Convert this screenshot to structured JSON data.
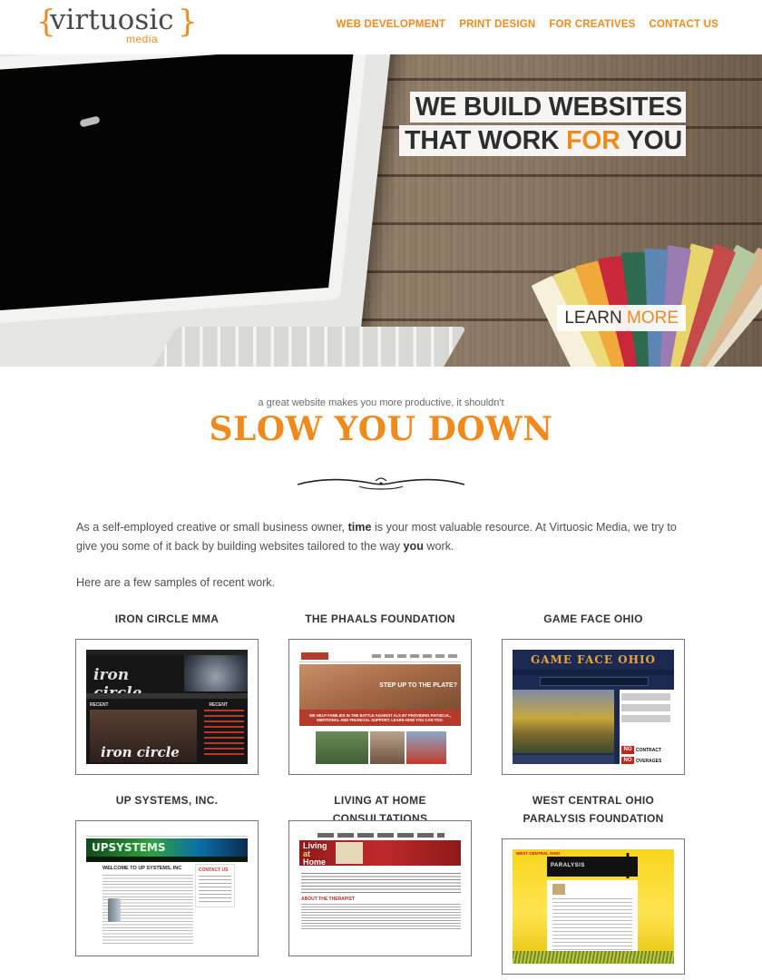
{
  "header": {
    "logo_word": "virtuosic",
    "logo_sub": "media",
    "logo_brace_left": "{",
    "logo_brace_right": "}",
    "nav": [
      "WEB DEVELOPMENT",
      "PRINT DESIGN",
      "FOR CREATIVES",
      "CONTACT US"
    ]
  },
  "hero": {
    "line1": "WE BUILD WEBSITES",
    "line2_a": "THAT WORK ",
    "line2_hl": "FOR",
    "line2_b": " YOU",
    "learn_a": "LEARN ",
    "learn_hl": "MORE"
  },
  "intro": {
    "kicker": "a great website makes you more productive, it shouldn't",
    "headline": "SLOW YOU DOWN",
    "p1_a": "As a self-employed creative or small business owner, ",
    "p1_b1": "time",
    "p1_c": " is your most valuable resource. At Virtuosic Media, we try to give you some of it back by building websites tailored to the way ",
    "p1_b2": "you",
    "p1_d": " work.",
    "p2": "Here are a few samples of recent work."
  },
  "portfolio": [
    {
      "title": "IRON CIRCLE MMA"
    },
    {
      "title": "THE PHAALS FOUNDATION"
    },
    {
      "title": "GAME FACE OHIO"
    },
    {
      "title": "UP SYSTEMS, INC."
    },
    {
      "title": "LIVING AT HOME CONSULTATIONS"
    },
    {
      "title": "WEST CENTRAL OHIO PARALYSIS FOUNDATION"
    }
  ],
  "thumbs": {
    "iron_logo": "iron circle",
    "iron_recent": "RECENT",
    "iron_recent2": "RECENT",
    "iron_team": "iron circle",
    "phaals_q": "STEP UP TO THE PLATE?",
    "phaals_strip": "WE HELP FAMILIES IN THE BATTLE AGAINST ALS BY PROVIDING PHYSICAL, EMOTIONAL AND FINANCIAL SUPPORT. LEARN HOW YOU CAN TOO.",
    "gfo_title": "GAME FACE OHIO",
    "gfo_no1": "NO",
    "gfo_no1_text": "CONTRACT",
    "gfo_no2": "NO",
    "gfo_no2_text": "OVERAGES",
    "up_banner": "UPSYSTEMS",
    "up_welcome": "WELCOME TO UP SYSTEMS, INC",
    "up_contact": "CONTACT US",
    "lah_title1": "Living",
    "lah_title2": "at",
    "lah_title3": "Home",
    "lah_sec": "ABOUT THE THERAPIST",
    "wco_top": "WEST CENTRAL OHIO",
    "wco_hdr": "PARALYSIS"
  },
  "colors": {
    "accent": "#f08a1c",
    "text": "#444444"
  }
}
